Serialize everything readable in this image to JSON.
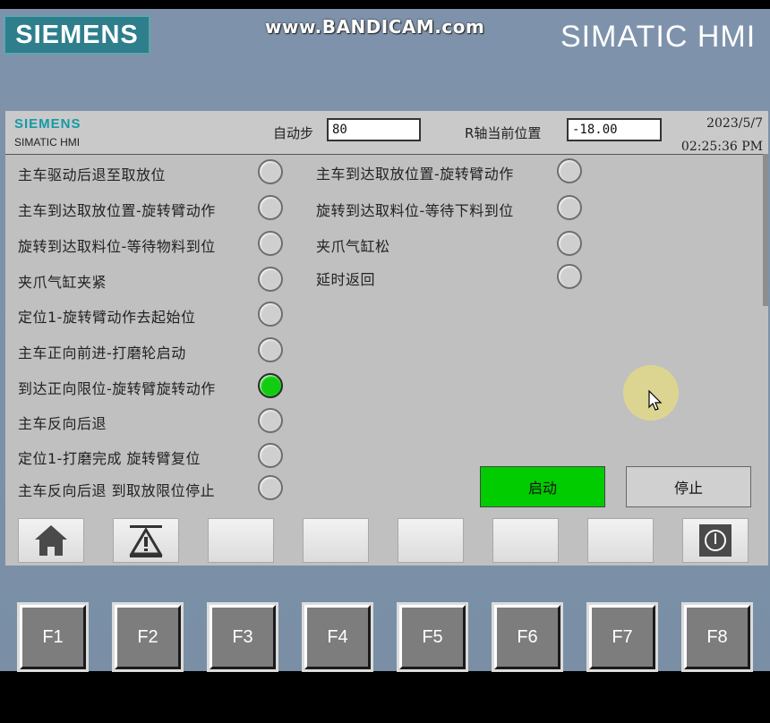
{
  "bezel": {
    "brand": "SIEMENS",
    "watermark": "www.BANDICAM.com",
    "product": "SIMATIC HMI"
  },
  "header": {
    "brand": "SIEMENS",
    "product": "SIMATIC HMI",
    "auto_step_label": "自动步",
    "auto_step_value": "80",
    "r_axis_label": "R轴当前位置",
    "r_axis_value": "-18.00",
    "date": "2023/5/7",
    "time": "02:25:36 PM"
  },
  "steps_left": [
    {
      "label": "主车驱动后退至取放位",
      "active": false
    },
    {
      "label": "主车到达取放位置-旋转臂动作",
      "active": false
    },
    {
      "label": "旋转到达取料位-等待物料到位",
      "active": false
    },
    {
      "label": "夹爪气缸夹紧",
      "active": false
    },
    {
      "label": "定位1-旋转臂动作去起始位",
      "active": false
    },
    {
      "label": "主车正向前进-打磨轮启动",
      "active": false
    },
    {
      "label": "到达正向限位-旋转臂旋转动作",
      "active": true
    },
    {
      "label": "主车反向后退",
      "active": false
    },
    {
      "label": "定位1-打磨完成 旋转臂复位",
      "active": false
    },
    {
      "label": "主车反向后退 到取放限位停止",
      "active": false
    }
  ],
  "steps_right": [
    {
      "label": "主车到达取放位置-旋转臂动作",
      "active": false
    },
    {
      "label": "旋转到达取料位-等待下料到位",
      "active": false
    },
    {
      "label": "夹爪气缸松",
      "active": false
    },
    {
      "label": "延时返回",
      "active": false
    }
  ],
  "buttons": {
    "start": "启动",
    "stop": "停止"
  },
  "nav_icons": [
    "home-icon",
    "alarm-warning-icon",
    "",
    "",
    "",
    "",
    "",
    "power-icon"
  ],
  "fkeys": [
    "F1",
    "F2",
    "F3",
    "F4",
    "F5",
    "F6",
    "F7",
    "F8"
  ],
  "colors": {
    "lamp_on": "#11cc11",
    "lamp_off": "#cfcfcf",
    "start_button": "#00cc00",
    "bezel": "#7c91a9",
    "logo_bg": "#2e7e8c"
  }
}
